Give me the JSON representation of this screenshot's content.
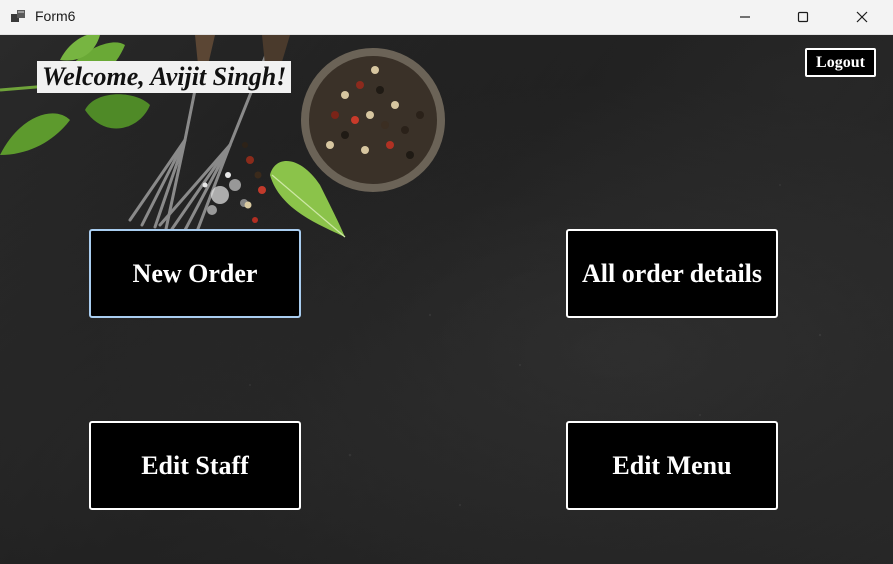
{
  "window": {
    "title": "Form6",
    "icon": "app-window-icon",
    "controls": {
      "minimize": "minimize-icon",
      "maximize": "maximize-icon",
      "close": "close-icon"
    }
  },
  "header": {
    "welcome_text": "Welcome, Avijit Singh!",
    "logout_label": "Logout"
  },
  "menu": {
    "new_order": "New Order",
    "all_order_details": "All order details",
    "edit_staff": "Edit Staff",
    "edit_menu": "Edit Menu"
  },
  "background": {
    "description_icons": [
      "basil-leaves-icon",
      "forks-icon",
      "peppercorn-bowl-icon",
      "salt-icon"
    ]
  },
  "colors": {
    "button_bg": "#000000",
    "button_text": "#ffffff",
    "focus_border": "#a9cdf0",
    "welcome_bg": "#f1f1f1"
  }
}
